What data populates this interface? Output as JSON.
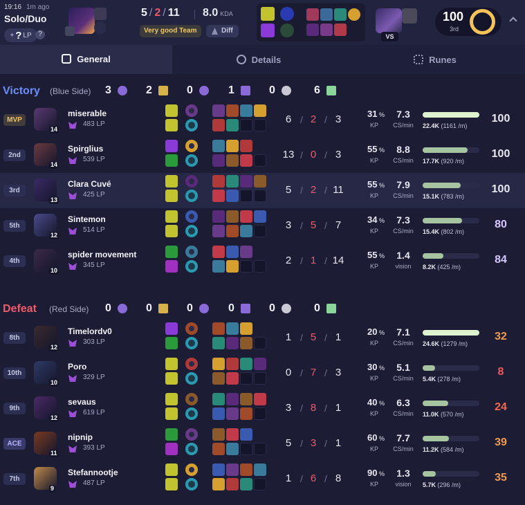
{
  "header": {
    "time": "19:16",
    "ago": "1m ago",
    "queue": "Solo/Duo",
    "lp_prefix": "+",
    "lp_value": "?",
    "lp_unit": "LP",
    "help": "?",
    "kills": "5",
    "deaths": "2",
    "assists": "11",
    "kda": "8.0",
    "kda_label": "KDA",
    "team_tag": "Very good Team",
    "diff_tag": "Diff",
    "vs": "VS",
    "score": "100",
    "rank": "3rd",
    "icons": {
      "champion": "champion-portrait-icon",
      "collapse": "chevron-up-icon"
    }
  },
  "tabs": [
    {
      "label": "General",
      "icon": "grid-icon"
    },
    {
      "label": "Details",
      "icon": "pie-icon"
    },
    {
      "label": "Runes",
      "icon": "dots-icon"
    }
  ],
  "teams": [
    {
      "result": "Victory",
      "side": "(Blue Side)",
      "color": "#6f8df7",
      "objectives": [
        "3",
        "2",
        "0",
        "1",
        "0",
        "6"
      ],
      "players": [
        {
          "rank": "MVP",
          "name": "miserable",
          "lp": "483 LP",
          "level": "14",
          "k": "6",
          "d": "2",
          "a": "3",
          "kp": "31",
          "kp_label": "KP",
          "cs": "7.3",
          "cs_label": "CS/min",
          "dmg": "22.4K",
          "dmg_rate": "(1161 /m)",
          "dmg_pct": 100,
          "score": "100",
          "score_color": "#e8e8f2",
          "color": "#5a3a72"
        },
        {
          "rank": "2nd",
          "name": "Spirglius",
          "lp": "539 LP",
          "level": "14",
          "k": "13",
          "d": "0",
          "a": "3",
          "kp": "55",
          "kp_label": "KP",
          "cs": "8.8",
          "cs_label": "CS/min",
          "dmg": "17.7K",
          "dmg_rate": "(920 /m)",
          "dmg_pct": 79,
          "score": "100",
          "score_color": "#e8e8f2",
          "color": "#6b3a40"
        },
        {
          "rank": "3rd",
          "name": "Clara Cuvé",
          "lp": "425 LP",
          "level": "13",
          "k": "5",
          "d": "2",
          "a": "11",
          "kp": "55",
          "kp_label": "KP",
          "cs": "7.9",
          "cs_label": "CS/min",
          "dmg": "15.1K",
          "dmg_rate": "(783 /m)",
          "dmg_pct": 67,
          "score": "100",
          "score_color": "#e8e8f2",
          "color": "#3a2a66",
          "me": true
        },
        {
          "rank": "5th",
          "name": "Sintemon",
          "lp": "514 LP",
          "level": "12",
          "k": "3",
          "d": "5",
          "a": "7",
          "kp": "34",
          "kp_label": "KP",
          "cs": "7.3",
          "cs_label": "CS/min",
          "dmg": "15.4K",
          "dmg_rate": "(802 /m)",
          "dmg_pct": 69,
          "score": "80",
          "score_color": "#d6c8ff",
          "color": "#4a4a8a"
        },
        {
          "rank": "4th",
          "name": "spider movement",
          "lp": "345 LP",
          "level": "10",
          "k": "2",
          "d": "1",
          "a": "14",
          "kp": "55",
          "kp_label": "KP",
          "cs": "1.4",
          "cs_label": "vision",
          "dmg": "8.2K",
          "dmg_rate": "(425 /m)",
          "dmg_pct": 37,
          "score": "84",
          "score_color": "#d6c8ff",
          "color": "#3c2a4a"
        }
      ]
    },
    {
      "result": "Defeat",
      "side": "(Red Side)",
      "color": "#ef5b6a",
      "objectives": [
        "0",
        "0",
        "0",
        "0",
        "0",
        "0"
      ],
      "players": [
        {
          "rank": "8th",
          "name": "Timelordv0",
          "lp": "303 LP",
          "level": "12",
          "k": "1",
          "d": "5",
          "a": "1",
          "kp": "20",
          "kp_label": "KP",
          "cs": "7.1",
          "cs_label": "CS/min",
          "dmg": "24.6K",
          "dmg_rate": "(1279 /m)",
          "dmg_pct": 100,
          "score": "32",
          "score_color": "#f19a4f",
          "color": "#3a2a30"
        },
        {
          "rank": "10th",
          "name": "Poro",
          "lp": "329 LP",
          "level": "10",
          "k": "0",
          "d": "7",
          "a": "3",
          "kp": "30",
          "kp_label": "KP",
          "cs": "5.1",
          "cs_label": "CS/min",
          "dmg": "5.4K",
          "dmg_rate": "(278 /m)",
          "dmg_pct": 22,
          "score": "8",
          "score_color": "#ef5b5b",
          "color": "#2e3a66"
        },
        {
          "rank": "9th",
          "name": "sevaus",
          "lp": "619 LP",
          "level": "12",
          "k": "3",
          "d": "8",
          "a": "1",
          "kp": "40",
          "kp_label": "KP",
          "cs": "6.3",
          "cs_label": "CS/min",
          "dmg": "11.0K",
          "dmg_rate": "(570 /m)",
          "dmg_pct": 45,
          "score": "24",
          "score_color": "#ef6a50",
          "color": "#4a2a66"
        },
        {
          "rank": "ACE",
          "name": "nipnip",
          "lp": "393 LP",
          "level": "11",
          "k": "5",
          "d": "3",
          "a": "1",
          "kp": "60",
          "kp_label": "KP",
          "cs": "7.7",
          "cs_label": "CS/min",
          "dmg": "11.2K",
          "dmg_rate": "(584 /m)",
          "dmg_pct": 46,
          "score": "39",
          "score_color": "#f19a4f",
          "color": "#7a3a20"
        },
        {
          "rank": "7th",
          "name": "Stefannootje",
          "lp": "487 LP",
          "level": "9",
          "k": "1",
          "d": "6",
          "a": "8",
          "kp": "90",
          "kp_label": "KP",
          "cs": "1.3",
          "cs_label": "vision",
          "dmg": "5.7K",
          "dmg_rate": "(296 /m)",
          "dmg_pct": 23,
          "score": "35",
          "score_color": "#f19a4f",
          "color": "#c08a4a"
        }
      ]
    }
  ],
  "colors": {
    "bar_win": "#dff2cf",
    "bar_win2": "#a7c4a0",
    "bar_loss": "#dff2cf",
    "accent": "#f3c35a"
  }
}
